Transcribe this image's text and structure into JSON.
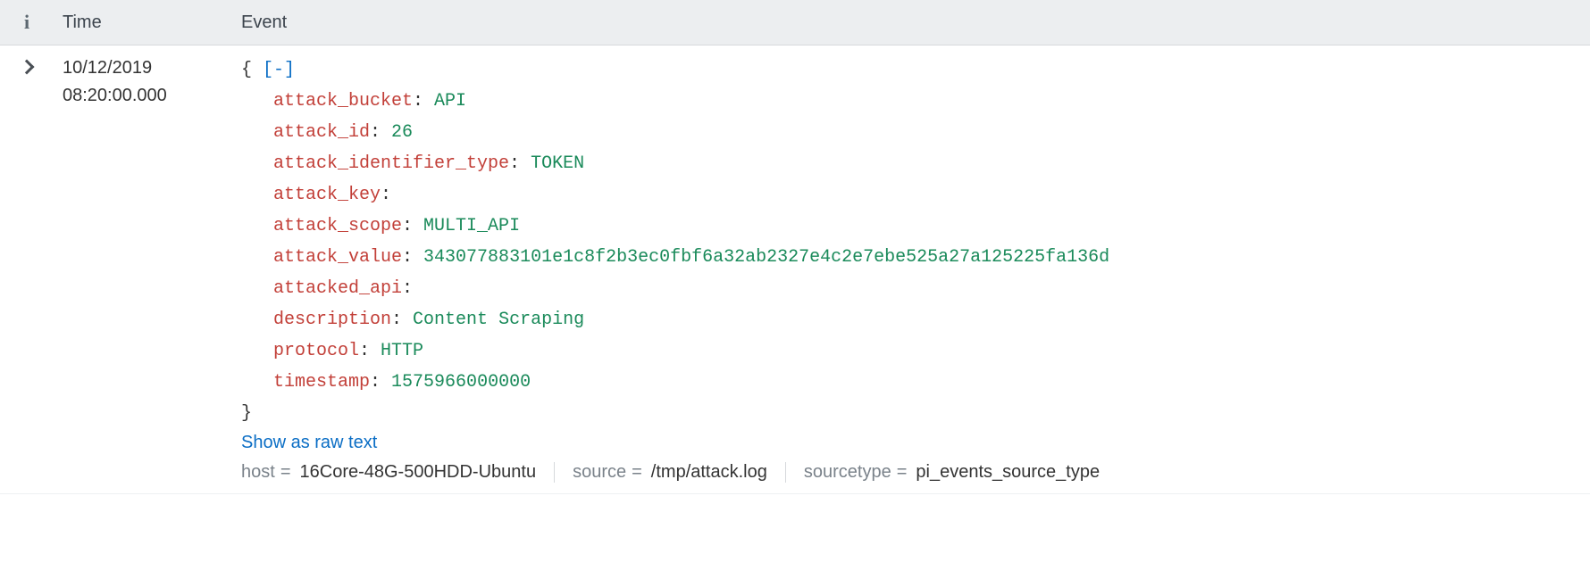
{
  "header": {
    "info_glyph": "i",
    "time_label": "Time",
    "event_label": "Event"
  },
  "row": {
    "time_date": "10/12/2019",
    "time_clock": "08:20:00.000",
    "json_open": "{",
    "json_collapse": "[-]",
    "json_close": "}",
    "fields": [
      {
        "key": "attack_bucket",
        "value": "API"
      },
      {
        "key": "attack_id",
        "value": "26"
      },
      {
        "key": "attack_identifier_type",
        "value": "TOKEN"
      },
      {
        "key": "attack_key",
        "value": ""
      },
      {
        "key": "attack_scope",
        "value": "MULTI_API"
      },
      {
        "key": "attack_value",
        "value": "343077883101e1c8f2b3ec0fbf6a32ab2327e4c2e7ebe525a27a125225fa136d"
      },
      {
        "key": "attacked_api",
        "value": ""
      },
      {
        "key": "description",
        "value": "Content Scraping"
      },
      {
        "key": "protocol",
        "value": "HTTP"
      },
      {
        "key": "timestamp",
        "value": "1575966000000"
      }
    ],
    "raw_text_label": "Show as raw text",
    "meta": {
      "host_key": "host",
      "host_val": "16Core-48G-500HDD-Ubuntu",
      "source_key": "source",
      "source_val": "/tmp/attack.log",
      "sourcetype_key": "sourcetype",
      "sourcetype_val": "pi_events_source_type",
      "eq": "="
    }
  }
}
